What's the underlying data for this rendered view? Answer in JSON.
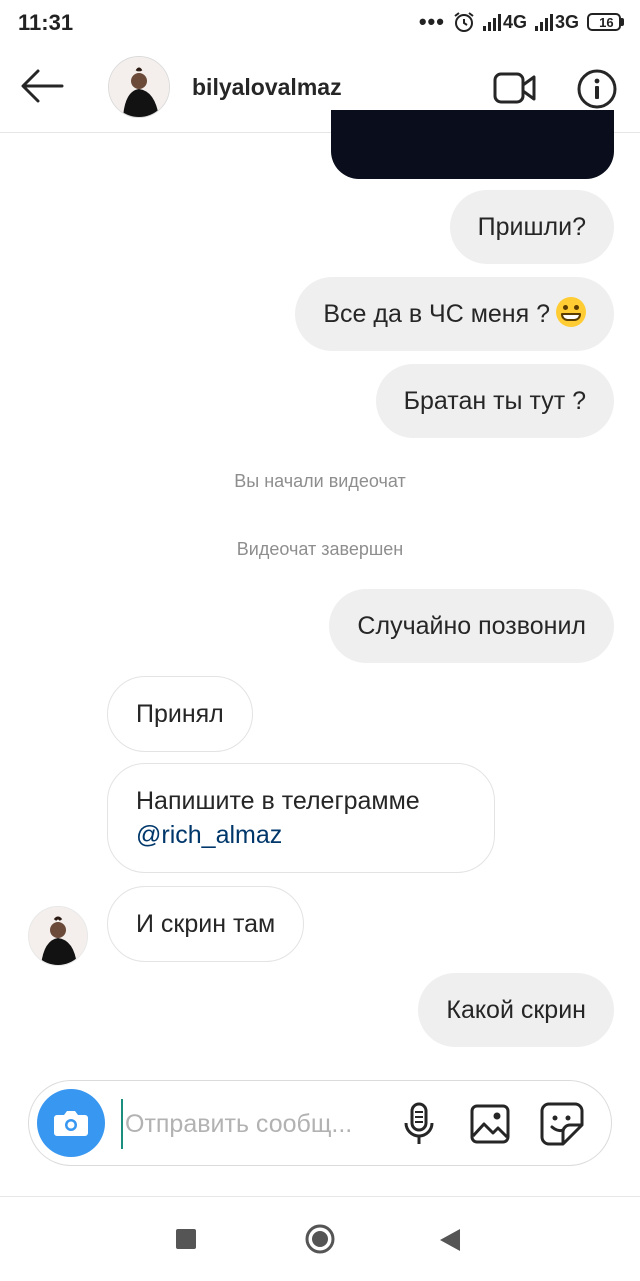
{
  "status_bar": {
    "time": "11:31",
    "dots": "•••",
    "network1": "4G",
    "network2": "3G",
    "battery": "16"
  },
  "header": {
    "username": "bilyalovalmaz",
    "icons": {
      "back": "arrow-left-icon",
      "video": "video-camera-icon",
      "info": "info-icon"
    }
  },
  "messages": [
    {
      "type": "outgoing",
      "text": "Пришли?"
    },
    {
      "type": "outgoing",
      "text": "Все да в ЧС меня ?",
      "emoji": "grinning-face"
    },
    {
      "type": "outgoing",
      "text": "Братан ты тут ?"
    },
    {
      "type": "system",
      "text": "Вы начали видеочат"
    },
    {
      "type": "system",
      "text": "Видеочат завершен"
    },
    {
      "type": "outgoing",
      "text": "Случайно позвонил"
    },
    {
      "type": "incoming",
      "text": "Принял"
    },
    {
      "type": "incoming",
      "text": "Напишите в телеграмме",
      "link": "@rich_almaz"
    },
    {
      "type": "incoming",
      "text": "И скрин там"
    },
    {
      "type": "outgoing",
      "text": "Какой скрин"
    }
  ],
  "composer": {
    "placeholder": "Отправить сообщ...",
    "icons": [
      "camera-icon",
      "microphone-icon",
      "gallery-icon",
      "sticker-icon"
    ]
  },
  "colors": {
    "accent": "#3897f0",
    "outgoing_bubble": "#efefef",
    "link": "#00376b",
    "system_text": "#8e8e8e"
  }
}
